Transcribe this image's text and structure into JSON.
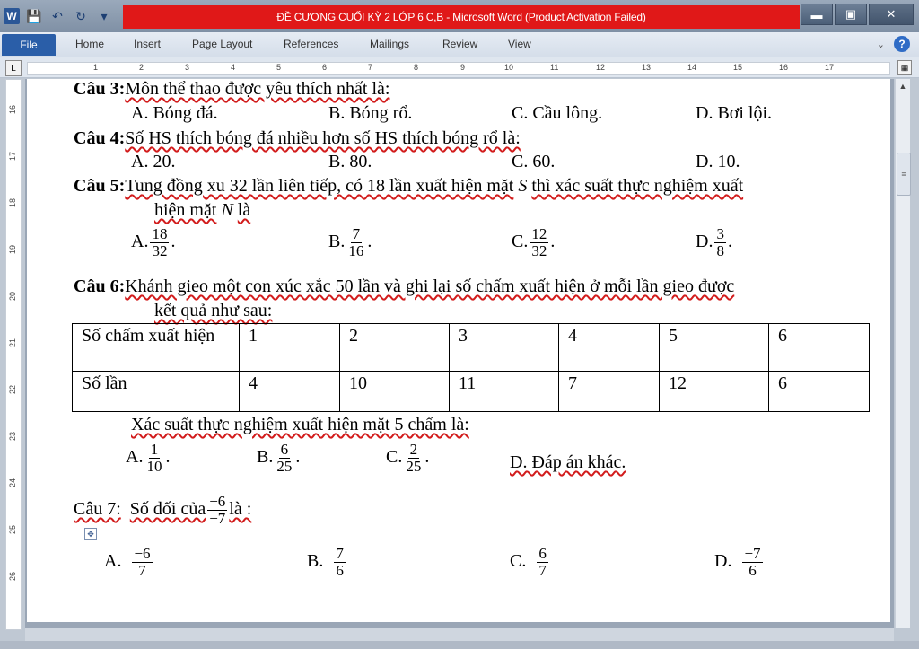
{
  "window": {
    "title": "ĐỀ CƯƠNG CUỐI KỲ 2 LỚP 6 C,B  -  Microsoft Word (Product Activation Failed)",
    "app_icon_letter": "W",
    "min": "▬",
    "max": "▣",
    "close": "✕"
  },
  "ribbon": {
    "file": "File",
    "tabs": [
      "Home",
      "Insert",
      "Page Layout",
      "References",
      "Mailings",
      "Review",
      "View"
    ],
    "help": "?",
    "minimize_ribbon": "⌄"
  },
  "ruler": {
    "corner": "L",
    "numbers": [
      "1",
      "2",
      "3",
      "4",
      "5",
      "6",
      "7",
      "8",
      "9",
      "10",
      "11",
      "12",
      "13",
      "14",
      "15",
      "16",
      "17"
    ]
  },
  "vruler": {
    "numbers": [
      "16",
      "17",
      "18",
      "19",
      "20",
      "21",
      "22",
      "23",
      "24",
      "25",
      "26"
    ]
  },
  "doc": {
    "q3": {
      "label": "Câu 3:",
      "text": "Môn thể thao được yêu thích nhất là:",
      "options": [
        "A. Bóng đá.",
        "B. Bóng rổ.",
        "C. Cầu lông.",
        "D. Bơi lội."
      ]
    },
    "q4": {
      "label": "Câu 4:",
      "text": "Số HS thích bóng đá nhiều hơn số HS thích bóng rổ là:",
      "options": [
        "A. 20.",
        "B. 80.",
        "C. 60.",
        "D. 10."
      ]
    },
    "q5": {
      "label": "Câu 5:",
      "text1": "Tung đồng xu 32 lần liên tiếp, có 18 lần xuất hiện mặt",
      "sym_s": "S",
      "text2": "thì xác suất thực nghiệm xuất",
      "text3": "hiện mặt",
      "sym_n": "N",
      "text4": "là",
      "options": [
        {
          "letter": "A.",
          "num": "18",
          "den": "32"
        },
        {
          "letter": "B.",
          "num": "7",
          "den": "16"
        },
        {
          "letter": "C.",
          "num": "12",
          "den": "32"
        },
        {
          "letter": "D.",
          "num": "3",
          "den": "8"
        }
      ]
    },
    "q6": {
      "label": "Câu 6:",
      "text1": "Khánh gieo một con xúc xắc 50 lần và ghi lại số chấm xuất hiện ở mỗi lần gieo được",
      "text2": "kết quả như sau:",
      "table": {
        "row1": [
          "Số chấm xuất hiện",
          "1",
          "2",
          "3",
          "4",
          "5",
          "6"
        ],
        "row2": [
          "Số lần",
          "4",
          "10",
          "11",
          "7",
          "12",
          "6"
        ]
      },
      "sub": "Xác suất thực nghiệm xuất hiện mặt 5 chấm là:",
      "options": [
        {
          "letter": "A.",
          "num": "1",
          "den": "10"
        },
        {
          "letter": "B.",
          "num": "6",
          "den": "25"
        },
        {
          "letter": "C.",
          "num": "2",
          "den": "25"
        }
      ],
      "option_d": "D. Đáp án khác."
    },
    "q7": {
      "label": "Câu 7:",
      "text1": "Số đối của",
      "num": "−6",
      "den": "−7",
      "text2": "là :",
      "options": [
        {
          "letter": "A.",
          "num": "−6",
          "den": "7"
        },
        {
          "letter": "B.",
          "num": "7",
          "den": "6"
        },
        {
          "letter": "C.",
          "num": "6",
          "den": "7"
        },
        {
          "letter": "D.",
          "num": "−7",
          "den": "6"
        }
      ]
    }
  },
  "scroll": {
    "up": "▲",
    "thumb": "≡"
  }
}
